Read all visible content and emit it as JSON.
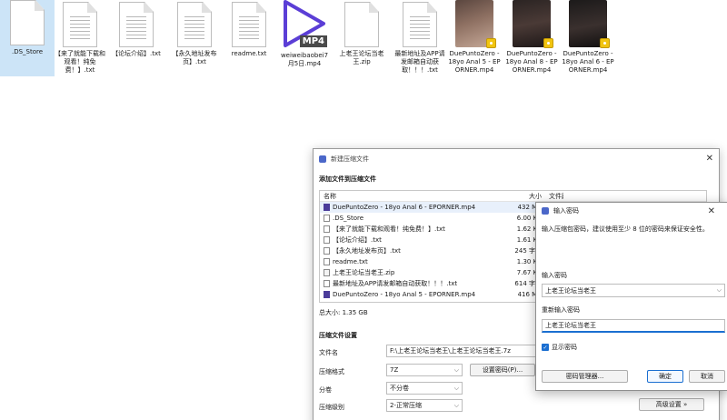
{
  "desktop": {
    "files": [
      {
        "label": ".DS_Store",
        "kind": "blank"
      },
      {
        "label": "【来了就能下载和观看！纯免费！】.txt",
        "kind": "txt"
      },
      {
        "label": "【论坛介绍】.txt",
        "kind": "txt"
      },
      {
        "label": "【永久地址发布页】.txt",
        "kind": "txt"
      },
      {
        "label": "readme.txt",
        "kind": "txt"
      },
      {
        "label": "weiweibaobei7月5日.mp4",
        "kind": "mp4",
        "badge": "MP4"
      },
      {
        "label": "上老王论坛当老王.zip",
        "kind": "zip"
      },
      {
        "label": "最新地址及APP请发邮箱自动获取！！！.txt",
        "kind": "txt"
      },
      {
        "label": "DuePuntoZero - 18yo Anal 5 - EPORNER.mp4",
        "kind": "video"
      },
      {
        "label": "DuePuntoZero - 18yo Anal 8 - EPORNER.mp4",
        "kind": "video"
      },
      {
        "label": "DuePuntoZero - 18yo Anal 6 - EPORNER.mp4",
        "kind": "video"
      }
    ]
  },
  "archive_dialog": {
    "title": "新建压缩文件",
    "add_files_header": "添加文件到压缩文件",
    "columns": {
      "name": "名称",
      "size": "大小",
      "path": "文件路径"
    },
    "rows": [
      {
        "name": "DuePuntoZero - 18yo Anal 6 - EPORNER.mp4",
        "size": "432 MB",
        "path": "F\\",
        "icon": "video"
      },
      {
        "name": ".DS_Store",
        "size": "6.00 KB",
        "path": "F\\",
        "icon": "doc"
      },
      {
        "name": "【来了就能下载和观看！纯免费！】.txt",
        "size": "1.62 KB",
        "path": "F\\",
        "icon": "doc"
      },
      {
        "name": "【论坛介绍】.txt",
        "size": "1.61 KB",
        "path": "F\\",
        "icon": "doc"
      },
      {
        "name": "【永久地址发布页】.txt",
        "size": "245 字节",
        "path": "F\\",
        "icon": "doc"
      },
      {
        "name": "readme.txt",
        "size": "1.30 KB",
        "path": "F\\",
        "icon": "doc"
      },
      {
        "name": "上老王论坛当老王.zip",
        "size": "7.67 KB",
        "path": "F\\",
        "icon": "zip"
      },
      {
        "name": "最新地址及APP请发邮箱自动获取！！！.txt",
        "size": "614 字节",
        "path": "F\\",
        "icon": "doc"
      },
      {
        "name": "DuePuntoZero - 18yo Anal 5 - EPORNER.mp4",
        "size": "416 MB",
        "path": "F\\",
        "icon": "video"
      }
    ],
    "total_size": "总大小: 1.35 GB",
    "settings_header": "压缩文件设置",
    "filename_label": "文件名",
    "filename_value": "F:\\上老王论坛当老王\\上老王论坛当老王.7z",
    "format_label": "压缩格式",
    "format_value": "7Z",
    "set_password_button": "设置密码(P)...",
    "volume_label": "分卷",
    "volume_value": "不分卷",
    "level_label": "压缩级别",
    "level_value": "2-正常压缩",
    "advanced_button": "高级设置 »"
  },
  "password_dialog": {
    "title": "输入密码",
    "hint": "输入压缩包密码，建议使用至少 8 位的密码来保证安全性。",
    "enter_label": "输入密码",
    "enter_value": "上老王论坛当老王",
    "reenter_label": "重新输入密码",
    "reenter_value": "上老王论坛当老王",
    "show_password": "显示密码",
    "manager_button": "密码管理器...",
    "ok_button": "确定",
    "cancel_button": "取消"
  }
}
